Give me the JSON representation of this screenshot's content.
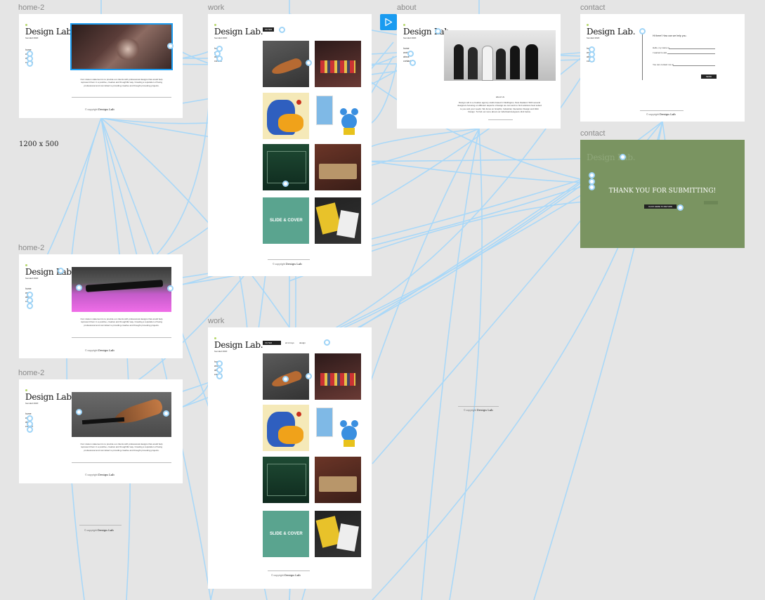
{
  "frames": {
    "home_a": {
      "label": "home-2"
    },
    "work_a": {
      "label": "work"
    },
    "about": {
      "label": "about"
    },
    "contact_a": {
      "label": "contact"
    },
    "contact_b": {
      "label": "contact"
    },
    "home_b": {
      "label": "home-2"
    },
    "home_c": {
      "label": "home-2"
    },
    "work_b": {
      "label": "work"
    }
  },
  "site": {
    "logo": "Design Lab.",
    "founded": "founded 2020",
    "nav_home": "home",
    "nav_work": "work",
    "nav_about": "about",
    "nav_contact": "contact",
    "mission": "Our mission statement is to provide our clients with professional designs that would help represent them in a positive, creative and thoughtful way. Creating a reputation of being professional and committed to providing creative and thought provoking projects.",
    "copyright_prefix": "© copyright",
    "copyright_brand": "Design Lab"
  },
  "work": {
    "filter_label": "FILTER",
    "filter_options": [
      "art & toys",
      "design"
    ]
  },
  "about": {
    "heading": "about Us",
    "body": "Design Lab is a creative agency studio based in Wellington, New Zealand. With several designers focusing on different aspects of design we can work to find solutions best suited to you and your needs. We focus on Graphic, Industrial, Interaction Design and Web Design. To find out more about our individual designers click below."
  },
  "contact": {
    "greeting": "Hi there! How can we help you.",
    "name_line": "Hello, my name is",
    "ask_line": "I wanted to ask",
    "reach_line": "You can contact me at",
    "send_label": "SEND",
    "thank_you": "THANK YOU FOR SUBMITTING!",
    "return_label": "CLICK HERE TO RETURN"
  },
  "canvas": {
    "size_note": "1200 x 500"
  },
  "colors": {
    "canvas_bg": "#e5e5e5",
    "wire": "#a9d8f8",
    "selection": "#1a9bf0",
    "success_green": "#7a9461",
    "logo_dot": "#b6d76b"
  },
  "icons": {
    "prototype_play": "play-icon"
  }
}
